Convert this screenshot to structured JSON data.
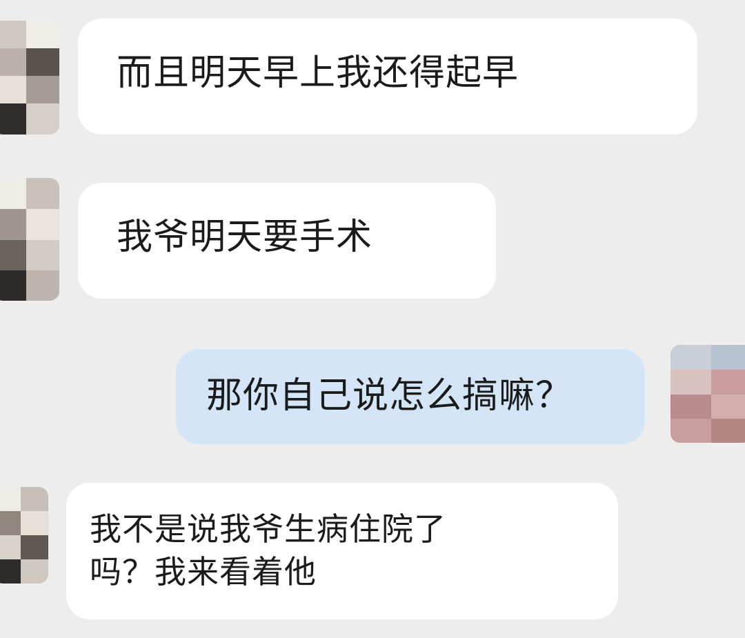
{
  "chat": {
    "messages": [
      {
        "sender": "other",
        "text": "而且明天早上我还得起早"
      },
      {
        "sender": "other",
        "text": "我爷明天要手术"
      },
      {
        "sender": "self",
        "text": "那你自己说怎么搞嘛？"
      },
      {
        "sender": "other",
        "lines": [
          "我不是说我爷生病住院了",
          "吗？我来看着他"
        ]
      }
    ]
  },
  "colors": {
    "background": "#ededed",
    "incoming_bubble": "#ffffff",
    "outgoing_bubble": "#d3e5f7",
    "text": "#1b1b1b"
  }
}
